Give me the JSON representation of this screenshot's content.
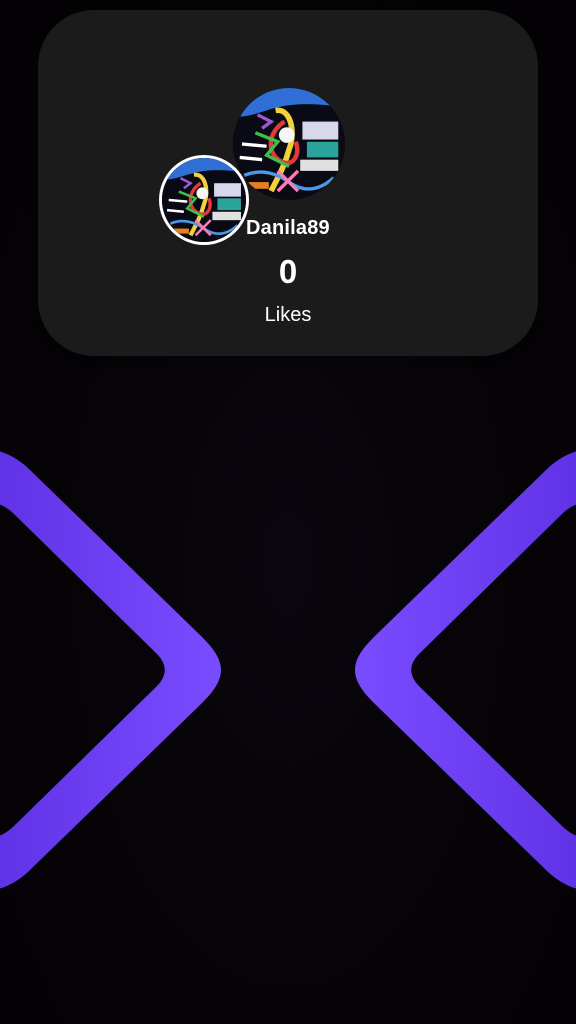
{
  "profile": {
    "username": "Danila89",
    "likes_count": "0",
    "likes_label": "Likes"
  },
  "colors": {
    "card_background": "#1b1b1b",
    "page_background": "#050306",
    "arrow_color": "#6a3cf2",
    "text": "#ffffff"
  },
  "icons": {
    "previous": "chevron-left-icon",
    "next": "chevron-right-icon"
  }
}
